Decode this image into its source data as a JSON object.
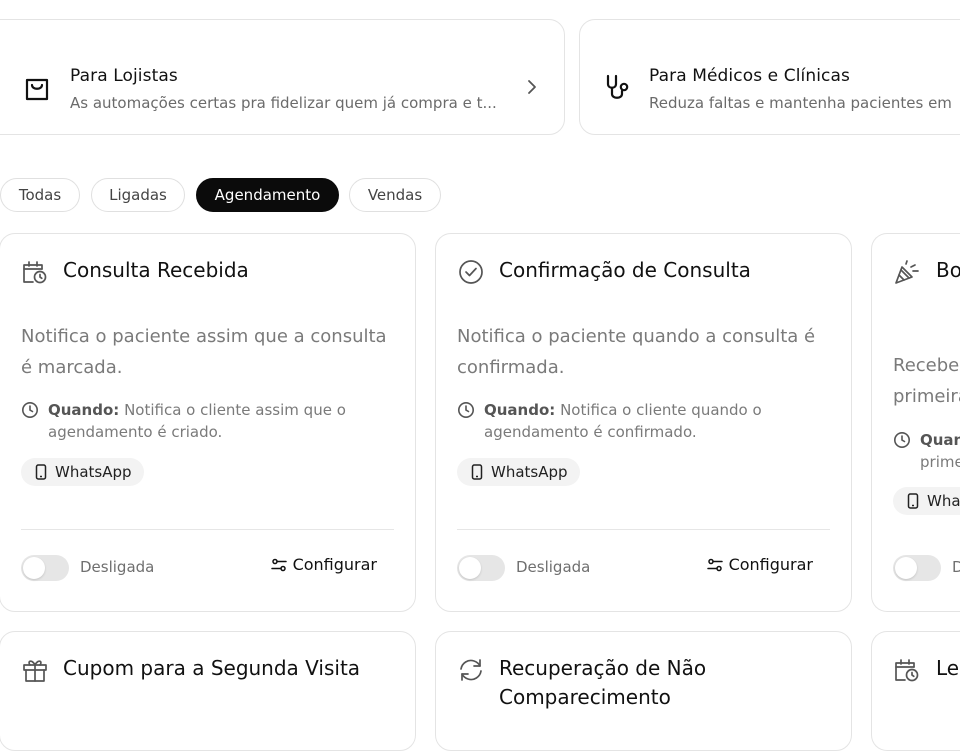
{
  "segments": [
    {
      "title": "Para Lojistas",
      "subtitle": "As automações certas pra fidelizar quem já compra e t...",
      "icon": "shopping-bag-icon"
    },
    {
      "title": "Para Médicos e Clínicas",
      "subtitle": "Reduza faltas e mantenha pacientes em",
      "icon": "stethoscope-icon"
    }
  ],
  "filters": {
    "items": [
      "Todas",
      "Ligadas",
      "Agendamento",
      "Vendas"
    ],
    "active": "Agendamento"
  },
  "cards": [
    {
      "title": "Consulta Recebida",
      "description": "Notifica o paciente assim que a consulta é marcada.",
      "when_label": "Quando:",
      "when_text": "Notifica o cliente assim que o agendamento é criado.",
      "channel": "WhatsApp",
      "status": "Desligada",
      "configure": "Configurar",
      "icon": "calendar-clock-icon"
    },
    {
      "title": "Confirmação de Consulta",
      "description": "Notifica o paciente quando a consulta é confirmada.",
      "when_label": "Quando:",
      "when_text": "Notifica o cliente quando o agendamento é confirmado.",
      "channel": "WhatsApp",
      "status": "Desligada",
      "configure": "Configurar",
      "icon": "check-circle-icon"
    },
    {
      "title": "Bo Co",
      "description": "Recebe primeira",
      "when_label": "Quan",
      "when_text": "prime",
      "channel": "Wha",
      "status": "D",
      "icon": "party-popper-icon"
    },
    {
      "title": "Cupom para a Segunda Visita",
      "icon": "gift-icon"
    },
    {
      "title": "Recuperação de Não Comparecimento",
      "icon": "refresh-icon"
    },
    {
      "title": "Le",
      "icon": "calendar-clock-icon"
    }
  ],
  "colors": {
    "active_chip_bg": "#0b0b0b",
    "border": "#e4e4e4",
    "muted_text": "#7a7a7a",
    "toggle_off": "#e6e6e6"
  }
}
